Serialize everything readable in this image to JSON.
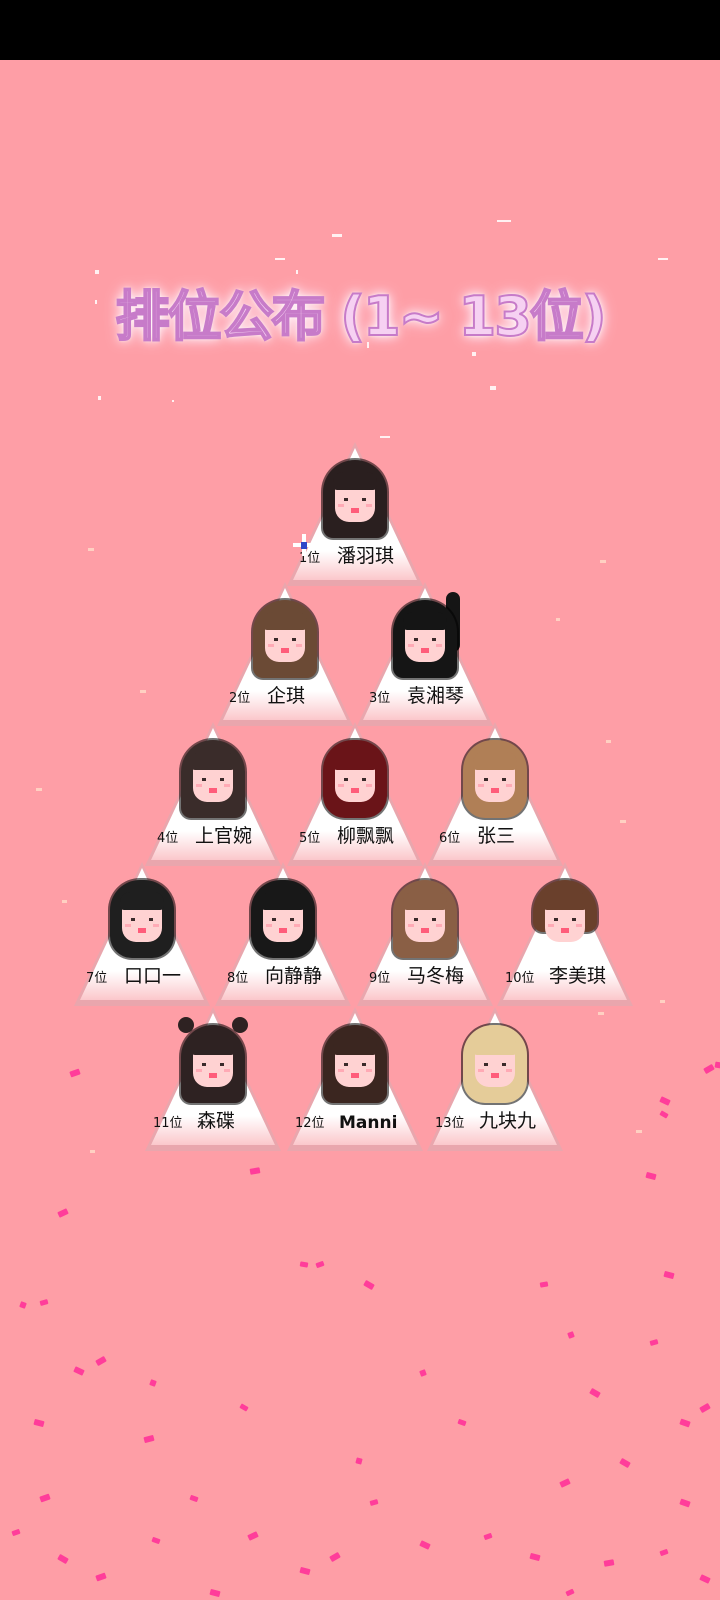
{
  "title": "排位公布 (1~ 13位)",
  "colors": {
    "background": "#fe9ea6",
    "status_bar": "#000000",
    "title_fill": "#f6d1f2",
    "title_stroke": "#c77bc9",
    "card_top": "#ffffff",
    "card_bottom": "#fbc7cb",
    "confetti": "#ff3d9a"
  },
  "rankings": [
    {
      "rank": "1位",
      "name": "潘羽琪",
      "hair": "#2a1f1f",
      "style": "long"
    },
    {
      "rank": "2位",
      "name": "企琪",
      "hair": "#6b4a35",
      "style": "long"
    },
    {
      "rank": "3位",
      "name": "袁湘琴",
      "hair": "#151515",
      "style": "ponytail"
    },
    {
      "rank": "4位",
      "name": "上官婉",
      "hair": "#3a2c2a",
      "style": "long"
    },
    {
      "rank": "5位",
      "name": "柳飘飘",
      "hair": "#6a1418",
      "style": "wavy"
    },
    {
      "rank": "6位",
      "name": "张三",
      "hair": "#b07f56",
      "style": "wavy"
    },
    {
      "rank": "7位",
      "name": "口口一",
      "hair": "#1f1f1f",
      "style": "wavy"
    },
    {
      "rank": "8位",
      "name": "向静静",
      "hair": "#181818",
      "style": "wavy"
    },
    {
      "rank": "9位",
      "name": "马冬梅",
      "hair": "#8a5f45",
      "style": "long"
    },
    {
      "rank": "10位",
      "name": "李美琪",
      "hair": "#6a402c",
      "style": "bob"
    },
    {
      "rank": "11位",
      "name": "森碟",
      "hair": "#2e2222",
      "style": "buns"
    },
    {
      "rank": "12位",
      "name": "Manni",
      "hair": "#3b2620",
      "style": "long"
    },
    {
      "rank": "13位",
      "name": "九块九",
      "hair": "#e5cc99",
      "style": "wavy"
    }
  ]
}
